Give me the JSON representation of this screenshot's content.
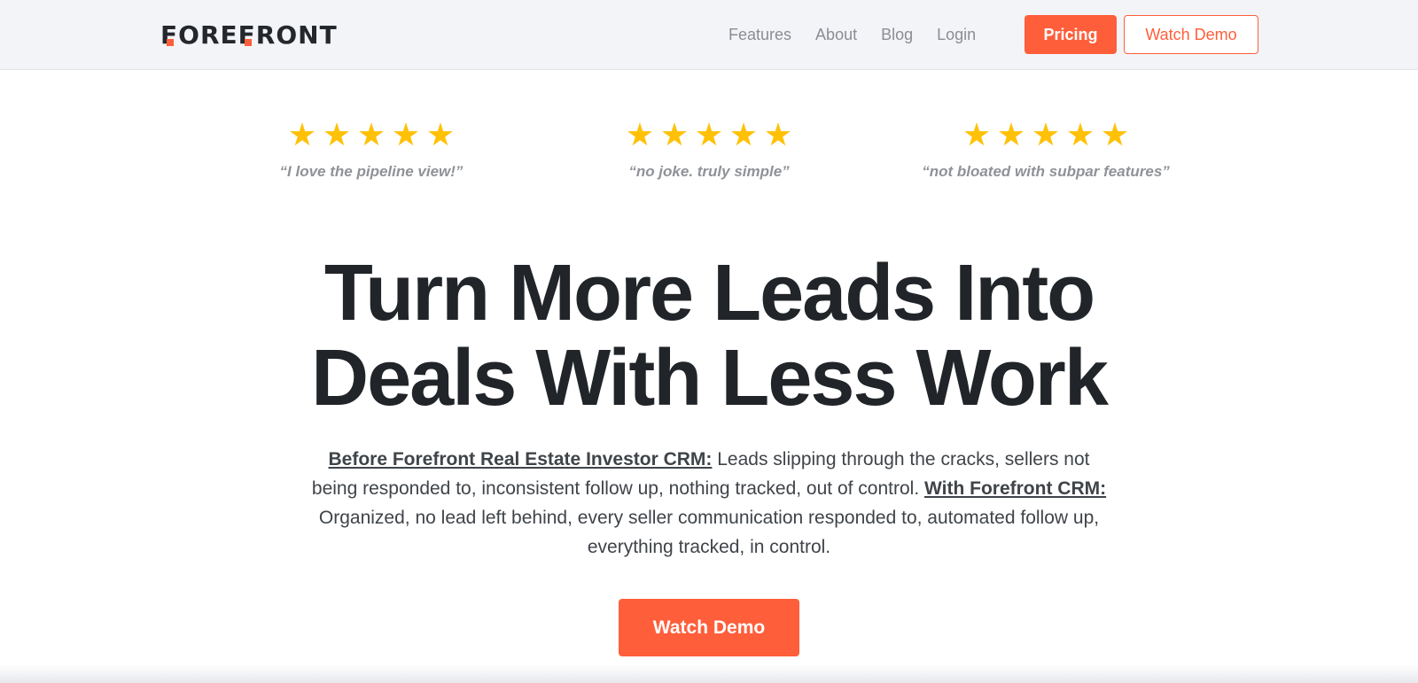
{
  "brand": {
    "logo_text": "FOREFRONT",
    "accent_color": "#ff5e3a",
    "text_color": "#24272b"
  },
  "nav": {
    "links": [
      "Features",
      "About",
      "Blog",
      "Login"
    ],
    "pricing_label": "Pricing",
    "watch_demo_label": "Watch Demo"
  },
  "reviews": [
    {
      "rating": 5,
      "quote": "“I love the pipeline view!”"
    },
    {
      "rating": 5,
      "quote": "“no joke. truly simple”"
    },
    {
      "rating": 5,
      "quote": "“not bloated with subpar features”"
    }
  ],
  "hero": {
    "headline_line1": "Turn More Leads Into",
    "headline_line2": "Deals With Less Work",
    "before_label": "Before Forefront Real Estate Investor CRM:",
    "before_text": " Leads slipping through the cracks, sellers not being responded to, inconsistent follow up, nothing tracked, out of control. ",
    "with_label": "With Forefront CRM:",
    "with_text": " Organized, no lead left behind, every seller communication responded to, automated follow up, everything tracked, in control.",
    "cta_label": "Watch Demo"
  },
  "icons": {
    "star": "star-icon"
  }
}
